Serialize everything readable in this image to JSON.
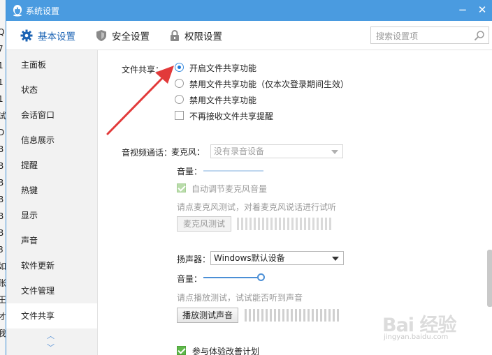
{
  "window": {
    "title": "系统设置"
  },
  "background_strip": [
    "Q",
    "7",
    "1",
    "1",
    "1",
    "试",
    "D",
    "B",
    "B",
    "B",
    "B",
    "B",
    "B",
    "8",
    "如",
    "账",
    "王",
    "才",
    "我"
  ],
  "toolbar": {
    "tabs": [
      {
        "label": "基本设置",
        "icon": "gear-icon",
        "active": true
      },
      {
        "label": "安全设置",
        "icon": "shield-icon",
        "active": false
      },
      {
        "label": "权限设置",
        "icon": "lock-icon",
        "active": false
      }
    ],
    "search_placeholder": "搜索设置项"
  },
  "sidebar": {
    "items": [
      "主面板",
      "状态",
      "会话窗口",
      "信息展示",
      "提醒",
      "热键",
      "显示",
      "声音",
      "软件更新",
      "文件管理",
      "文件共享"
    ],
    "active": "文件共享"
  },
  "file_sharing": {
    "label": "文件共享：",
    "options": [
      {
        "label": "开启文件共享功能",
        "selected": true
      },
      {
        "label": "禁用文件共享功能（仅本次登录期间生效）",
        "selected": false
      },
      {
        "label": "禁用文件共享功能",
        "selected": false
      }
    ],
    "no_remind": {
      "label": "不再接收文件共享提醒",
      "checked": false
    }
  },
  "av_call": {
    "label": "音视频通话：",
    "mic": {
      "label": "麦克风：",
      "selected": "没有录音设备",
      "volume_label": "音量：",
      "auto_adjust": {
        "label": "自动调节麦克风音量",
        "checked": true,
        "disabled": true
      },
      "hint": "请点麦克风测试，对着麦克风说话进行试听",
      "test_button": "麦克风测试"
    },
    "speaker": {
      "label": "扬声器：",
      "selected": "Windows默认设备",
      "volume_label": "音量：",
      "volume_fraction": 1.0,
      "hint": "请点播放测试，试试能否听到声音",
      "test_button": "播放测试声音"
    },
    "improvement": {
      "label": "参与体验改善计划",
      "checked": true
    }
  },
  "watermark": {
    "main": "Bai 经验",
    "sub": "jingyan.baidu.com"
  },
  "colors": {
    "titlebar": "#4a9be0",
    "accent": "#1b63b4",
    "annotation_arrow": "#e23a3a",
    "check_green": "#5fb84a"
  }
}
